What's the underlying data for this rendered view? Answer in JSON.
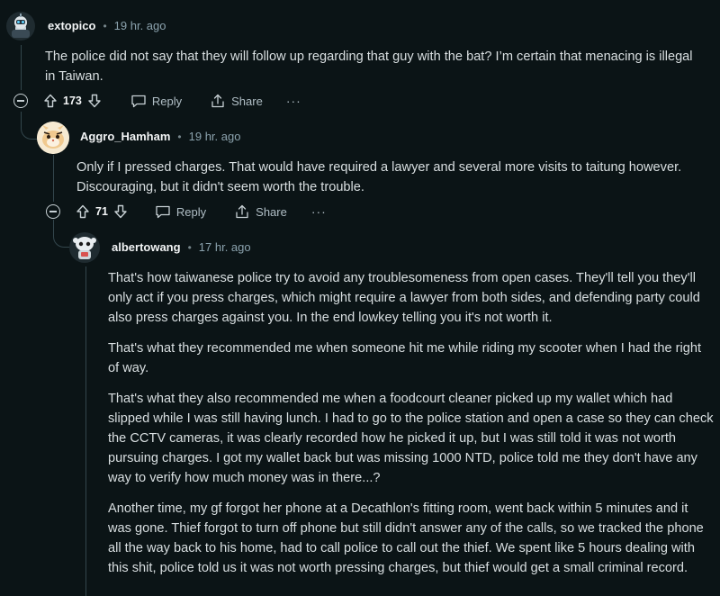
{
  "comments": [
    {
      "username": "extopico",
      "separator": "•",
      "time": "19 hr. ago",
      "lines": [
        "The police did not say that they will follow up regarding that guy with the bat? I’m certain that menacing is illegal",
        "in Taiwan."
      ],
      "votes": "173",
      "reply_label": "Reply",
      "share_label": "Share",
      "more_label": "···"
    },
    {
      "username": "Aggro_Hamham",
      "separator": "•",
      "time": "19 hr. ago",
      "lines": [
        "Only if I pressed charges. That would have required a lawyer and several more visits to taitung however.",
        "Discouraging, but it didn't seem worth the trouble."
      ],
      "votes": "71",
      "reply_label": "Reply",
      "share_label": "Share",
      "more_label": "···"
    },
    {
      "username": "albertowang",
      "separator": "•",
      "time": "17 hr. ago",
      "paragraphs": [
        [
          "That's how taiwanese police try to avoid any troublesomeness from open cases. They'll tell you they'll",
          "only act if you press charges, which might require a lawyer from both sides, and defending party could",
          "also press charges against you. In the end lowkey telling you it's not worth it."
        ],
        [
          "That's what they recommended me when someone hit me while riding my scooter when I had the right",
          "of way."
        ],
        [
          "That's what they also recommended me when a foodcourt cleaner picked up my wallet which had",
          "slipped while I was still having lunch. I had to go to the police station and open a case so they can check",
          "the CCTV cameras, it was clearly recorded how he picked it up, but I was still told it was not worth",
          "pursuing charges. I got my wallet back but was missing 1000 NTD, police told me they don't have any",
          "way to verify how much money was in there...?"
        ],
        [
          "Another time, my gf forgot her phone at a Decathlon's fitting room, went back within 5 minutes and it",
          "was gone. Thief forgot to turn off phone but still didn't answer any of the calls, so we tracked the phone",
          "all the way back to his home, had to call police to call out the thief. We spent like 5 hours dealing with",
          "this shit, police told us it was not worth pressing charges, but thief would get a small criminal record."
        ]
      ]
    }
  ]
}
